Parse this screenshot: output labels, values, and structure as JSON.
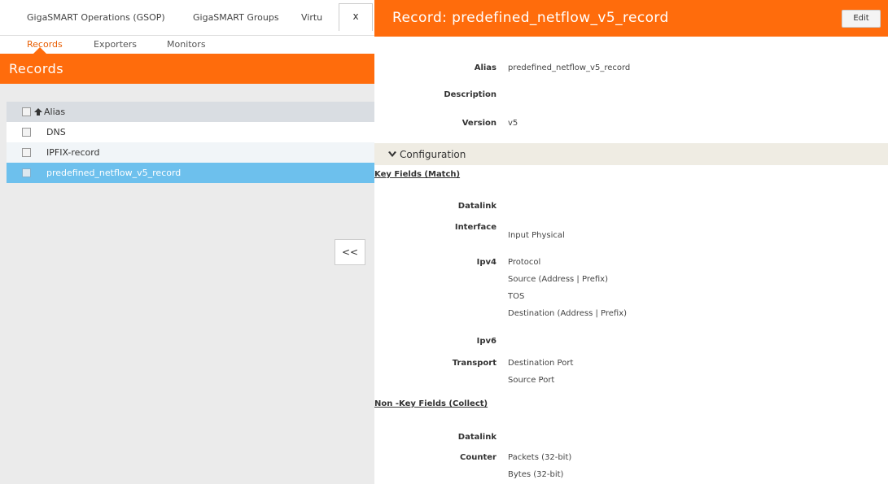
{
  "topnav": {
    "tabs": [
      "GigaSMART Operations (GSOP)",
      "GigaSMART Groups",
      "Virtu"
    ]
  },
  "subnav": {
    "tabs": [
      "Records",
      "Exporters",
      "Monitors"
    ]
  },
  "left_panel": {
    "title": "Records",
    "table": {
      "header": "Alias",
      "rows": [
        "DNS",
        "IPFIX-record",
        "predefined_netflow_v5_record"
      ]
    },
    "close_label": "x",
    "collapse_label": "<<"
  },
  "detail": {
    "title": "Record: predefined_netflow_v5_record",
    "edit_label": "Edit",
    "alias_label": "Alias",
    "alias_value": "predefined_netflow_v5_record",
    "description_label": "Description",
    "version_label": "Version",
    "version_value": "v5",
    "config_label": "Configuration",
    "key_fields_title": "Key Fields (Match)",
    "key_datalink_label": "Datalink",
    "interface_label": "Interface",
    "interface_values": [
      "Input Physical"
    ],
    "ipv4_label": "Ipv4",
    "ipv4_values": [
      "Protocol",
      "Source (Address | Prefix)",
      "TOS",
      "Destination (Address | Prefix)"
    ],
    "ipv6_label": "Ipv6",
    "transport_label": "Transport",
    "transport_values": [
      "Destination Port",
      "Source Port"
    ],
    "nonkey_title": "Non -Key Fields (Collect)",
    "nonkey_datalink_label": "Datalink",
    "counter_label": "Counter",
    "counter_values": [
      "Packets (32-bit)",
      "Bytes (32-bit)"
    ]
  },
  "colors": {
    "accent": "#ff6c0c",
    "selected_row": "#6dc0ed",
    "config_band": "#efece3"
  }
}
